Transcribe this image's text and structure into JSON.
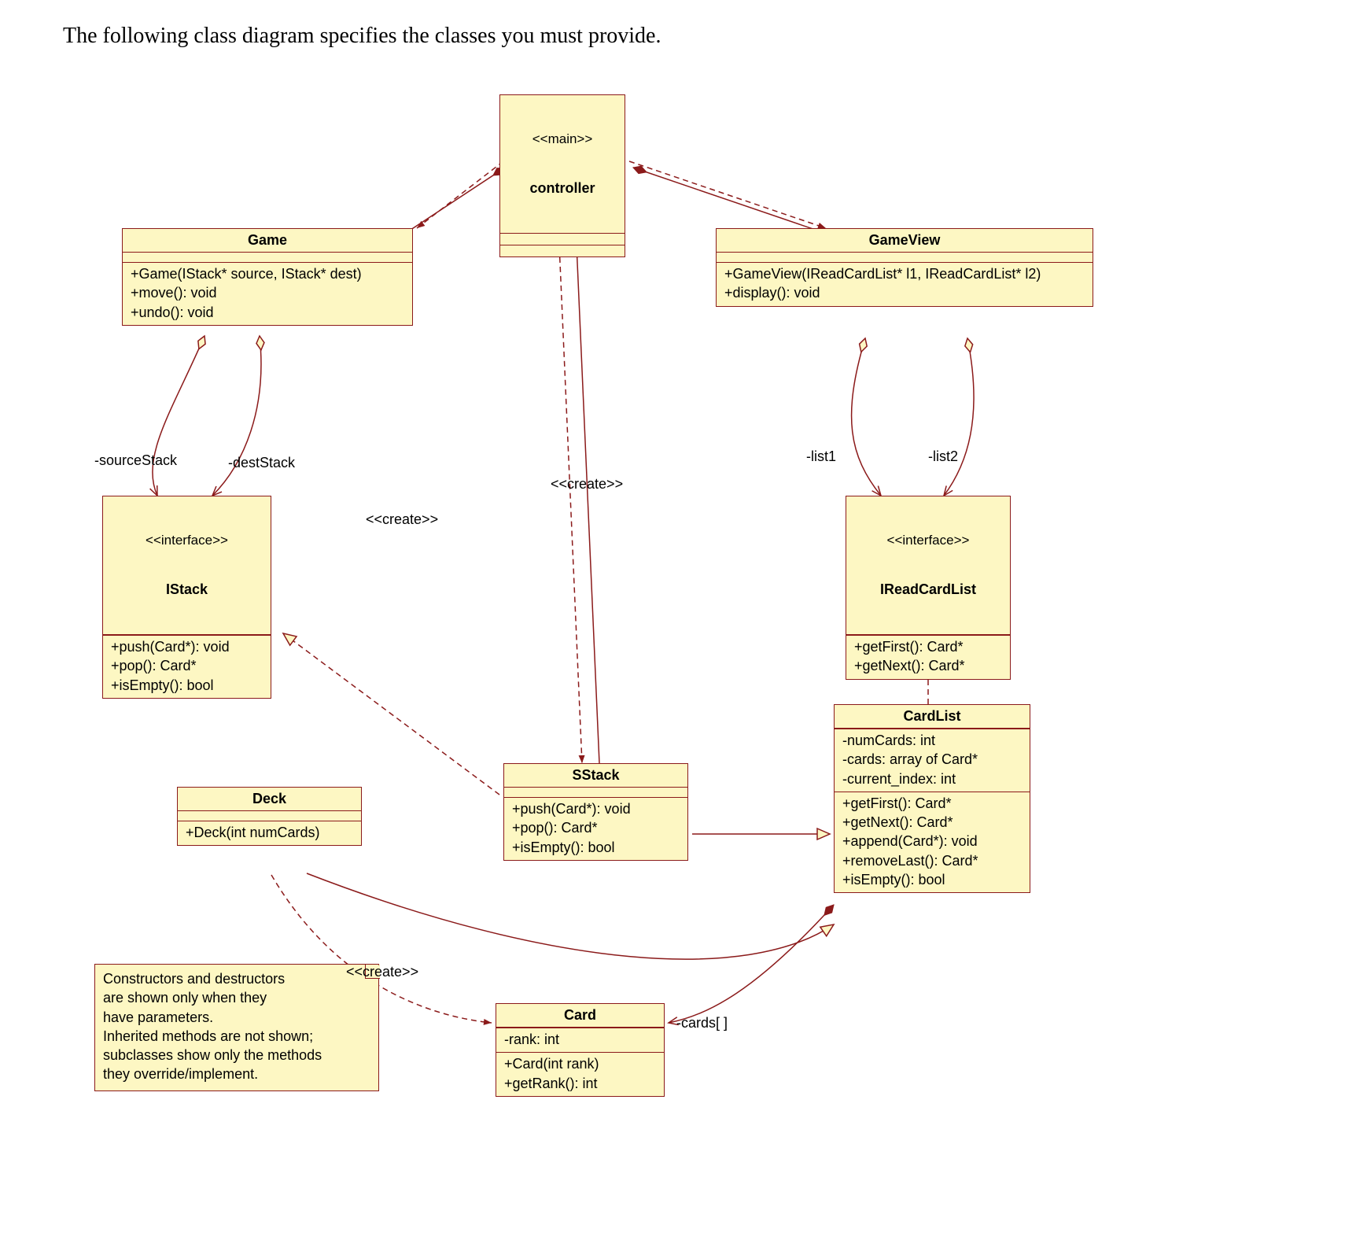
{
  "caption": "The following class diagram specifies the classes you must provide.",
  "controller": {
    "stereo": "<<main>>",
    "name": "controller"
  },
  "game": {
    "name": "Game",
    "ops": "+Game(IStack* source, IStack* dest)\n+move(): void\n+undo(): void"
  },
  "gameview": {
    "name": "GameView",
    "ops": "+GameView(IReadCardList* l1, IReadCardList* l2)\n+display(): void"
  },
  "istack": {
    "stereo": "<<interface>>",
    "name": "IStack",
    "ops": "+push(Card*): void\n+pop(): Card*\n+isEmpty(): bool"
  },
  "ireadcardlist": {
    "stereo": "<<interface>>",
    "name": "IReadCardList",
    "ops": "+getFirst(): Card*\n+getNext(): Card*"
  },
  "sstack": {
    "name": "SStack",
    "ops": "+push(Card*): void\n+pop(): Card*\n+isEmpty(): bool"
  },
  "cardlist": {
    "name": "CardList",
    "attrs": "-numCards: int\n-cards: array of Card*\n-current_index: int",
    "ops": "+getFirst(): Card*\n+getNext(): Card*\n+append(Card*): void\n+removeLast(): Card*\n+isEmpty(): bool"
  },
  "deck": {
    "name": "Deck",
    "ops": "+Deck(int numCards)"
  },
  "card": {
    "name": "Card",
    "attrs": "-rank: int",
    "ops": "+Card(int rank)\n+getRank(): int"
  },
  "note": {
    "text": "Constructors and destructors\nare shown only when they\nhave parameters.\nInherited methods are not shown;\nsubclasses show only the methods\nthey override/implement."
  },
  "labels": {
    "sourceStack": "-sourceStack",
    "destStack": "-destStack",
    "list1": "-list1",
    "list2": "-list2",
    "cards": "-cards[ ]",
    "create1": "<<create>>",
    "create2": "<<create>>",
    "create3": "<<create>>"
  }
}
